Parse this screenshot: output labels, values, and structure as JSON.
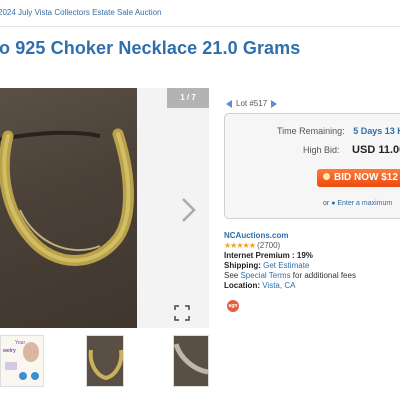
{
  "breadcrumb": "2024 July Vista Collectors Estate Sale Auction",
  "title": "o 925 Choker Necklace 21.0 Grams",
  "gallery": {
    "counter": "1 / 7",
    "thumb1_lines": [
      "Your",
      "welry"
    ]
  },
  "lot": {
    "label": "Lot #517"
  },
  "bid": {
    "time_label": "Time Remaining:",
    "time_value": "5 Days 13 H",
    "high_label": "High Bid:",
    "high_value": "USD 11.00",
    "bid_button": "BID NOW $12",
    "or_text": "or",
    "max_link": "Enter a maximum"
  },
  "seller": {
    "name": "NCAuctions.com",
    "stars": "★★★★★",
    "rating_count": "(2700)",
    "premium": "Internet Premium : 19%",
    "shipping_label": "Shipping:",
    "shipping_link": "Get Estimate",
    "see_text": "See",
    "terms_link": "Special Terms",
    "terms_suffix": "for additional fees",
    "location_label": "Location:",
    "location_value": "Vista, CA",
    "badge": "agn"
  },
  "colors": {
    "link_blue": "#2f6fab",
    "bid_orange": "#ec4a0f",
    "star_gold": "#f0a020"
  }
}
